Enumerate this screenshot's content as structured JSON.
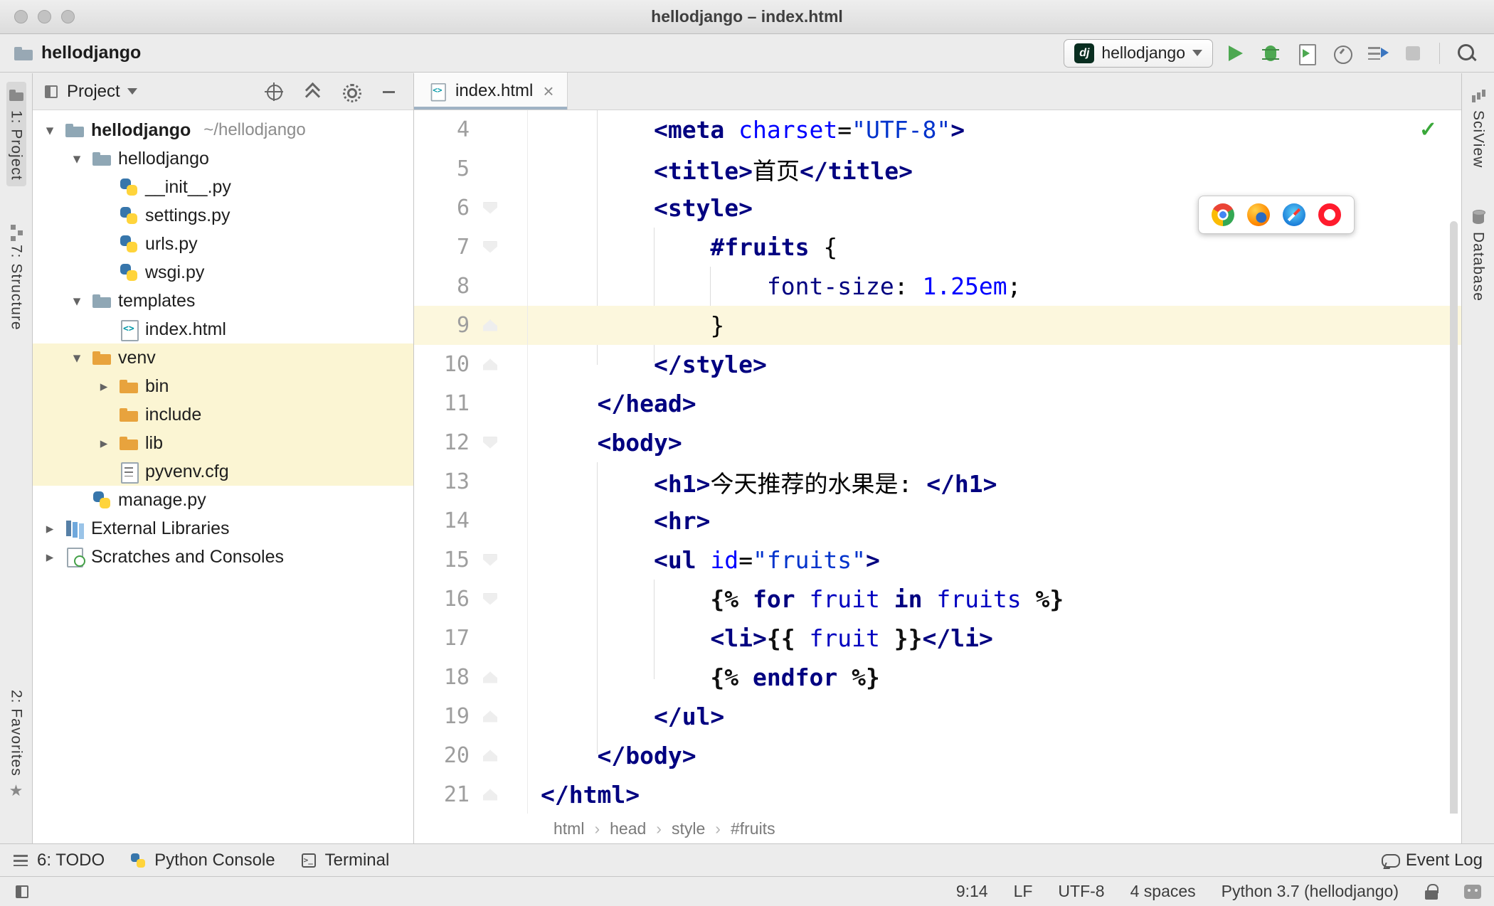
{
  "window": {
    "title": "hellodjango – index.html"
  },
  "toolbar": {
    "breadcrumb": "hellodjango",
    "run_config": "hellodjango",
    "run_config_icon_text": "dj",
    "actions": [
      "run",
      "debug",
      "run-with-coverage",
      "profiler",
      "concurrency-diagram",
      "stop"
    ],
    "search": "search-everywhere"
  },
  "colors": {
    "run_green": "#4DA851",
    "venv_highlight": "#fbf5d3",
    "current_line": "#fcf7dd",
    "tab_underline": "#9fb2c4"
  },
  "stripes": {
    "left_top": [
      {
        "label": "1: Project"
      },
      {
        "label": "7: Structure"
      }
    ],
    "left_bottom": [
      {
        "label": "2: Favorites"
      }
    ],
    "right_top": [
      {
        "label": "SciView"
      },
      {
        "label": "Database"
      }
    ]
  },
  "project": {
    "header": "Project",
    "header_actions": [
      "locate",
      "collapse-all",
      "settings",
      "hide"
    ],
    "tree": [
      {
        "label": "hellodjango",
        "hint": "~/hellodjango",
        "icon": "folder",
        "depth": 0,
        "chevron": "open",
        "bold": true
      },
      {
        "label": "hellodjango",
        "icon": "folder",
        "depth": 1,
        "chevron": "open"
      },
      {
        "label": "__init__.py",
        "icon": "python",
        "depth": 2
      },
      {
        "label": "settings.py",
        "icon": "python",
        "depth": 2
      },
      {
        "label": "urls.py",
        "icon": "python",
        "depth": 2
      },
      {
        "label": "wsgi.py",
        "icon": "python",
        "depth": 2
      },
      {
        "label": "templates",
        "icon": "folder",
        "depth": 1,
        "chevron": "open"
      },
      {
        "label": "index.html",
        "icon": "html",
        "depth": 2
      },
      {
        "label": "venv",
        "icon": "folder-orange",
        "depth": 1,
        "chevron": "open",
        "highlight": true
      },
      {
        "label": "bin",
        "icon": "folder-orange",
        "depth": 2,
        "chevron": "closed",
        "highlight": true
      },
      {
        "label": "include",
        "icon": "folder-orange",
        "depth": 2,
        "highlight": true
      },
      {
        "label": "lib",
        "icon": "folder-orange",
        "depth": 2,
        "chevron": "closed",
        "highlight": true
      },
      {
        "label": "pyvenv.cfg",
        "icon": "cfg",
        "depth": 2,
        "highlight": true
      },
      {
        "label": "manage.py",
        "icon": "python",
        "depth": 1
      },
      {
        "label": "External Libraries",
        "icon": "libraries",
        "depth": 0,
        "chevron": "closed"
      },
      {
        "label": "Scratches and Consoles",
        "icon": "scratches",
        "depth": 0,
        "chevron": "closed"
      }
    ]
  },
  "editor": {
    "tab": {
      "label": "index.html",
      "close": "×"
    },
    "inspection": "✓",
    "current_line": 9,
    "browser_popup": [
      "chrome",
      "firefox",
      "safari",
      "opera"
    ],
    "breadcrumbs": [
      "html",
      "head",
      "style",
      "#fruits"
    ],
    "lines": [
      {
        "n": 4,
        "indent": 8,
        "fold": null,
        "tokens": [
          [
            "tag",
            "<meta"
          ],
          [
            "pl",
            " "
          ],
          [
            "attr",
            "charset"
          ],
          [
            "pl",
            "="
          ],
          [
            "str",
            "\"UTF-8\""
          ],
          [
            "tag",
            ">"
          ]
        ]
      },
      {
        "n": 5,
        "indent": 8,
        "fold": null,
        "tokens": [
          [
            "tag",
            "<title>"
          ],
          [
            "pl",
            "首页"
          ],
          [
            "tag",
            "</title>"
          ]
        ]
      },
      {
        "n": 6,
        "indent": 8,
        "fold": "down",
        "tokens": [
          [
            "tag",
            "<style>"
          ]
        ]
      },
      {
        "n": 7,
        "indent": 12,
        "fold": "down",
        "tokens": [
          [
            "sel",
            "#fruits"
          ],
          [
            "pl",
            " {"
          ]
        ]
      },
      {
        "n": 8,
        "indent": 16,
        "fold": null,
        "tokens": [
          [
            "prop",
            "font-size"
          ],
          [
            "pl",
            ": "
          ],
          [
            "num",
            "1.25em"
          ],
          [
            "pl",
            ";"
          ]
        ]
      },
      {
        "n": 9,
        "indent": 12,
        "fold": "up",
        "tokens": [
          [
            "pl",
            "}"
          ]
        ]
      },
      {
        "n": 10,
        "indent": 8,
        "fold": "up",
        "tokens": [
          [
            "tag",
            "</style>"
          ]
        ]
      },
      {
        "n": 11,
        "indent": 4,
        "fold": null,
        "tokens": [
          [
            "tag",
            "</head>"
          ]
        ]
      },
      {
        "n": 12,
        "indent": 4,
        "fold": "down",
        "tokens": [
          [
            "tag",
            "<body>"
          ]
        ]
      },
      {
        "n": 13,
        "indent": 8,
        "fold": null,
        "tokens": [
          [
            "tag",
            "<h1>"
          ],
          [
            "pl",
            "今天推荐的水果是: "
          ],
          [
            "tag",
            "</h1>"
          ]
        ]
      },
      {
        "n": 14,
        "indent": 8,
        "fold": null,
        "tokens": [
          [
            "tag",
            "<hr>"
          ]
        ]
      },
      {
        "n": 15,
        "indent": 8,
        "fold": "down",
        "tokens": [
          [
            "tag",
            "<ul"
          ],
          [
            "pl",
            " "
          ],
          [
            "attr",
            "id"
          ],
          [
            "pl",
            "="
          ],
          [
            "str",
            "\"fruits\""
          ],
          [
            "tag",
            ">"
          ]
        ]
      },
      {
        "n": 16,
        "indent": 12,
        "fold": "down",
        "tokens": [
          [
            "br",
            "{%"
          ],
          [
            "pl",
            " "
          ],
          [
            "kw",
            "for"
          ],
          [
            "pl",
            " "
          ],
          [
            "var",
            "fruit"
          ],
          [
            "pl",
            " "
          ],
          [
            "kw",
            "in"
          ],
          [
            "pl",
            " "
          ],
          [
            "var",
            "fruits"
          ],
          [
            "pl",
            " "
          ],
          [
            "br",
            "%}"
          ]
        ]
      },
      {
        "n": 17,
        "indent": 12,
        "fold": null,
        "tokens": [
          [
            "tag",
            "<li>"
          ],
          [
            "br",
            "{{"
          ],
          [
            "pl",
            " "
          ],
          [
            "var",
            "fruit"
          ],
          [
            "pl",
            " "
          ],
          [
            "br",
            "}}"
          ],
          [
            "tag",
            "</li>"
          ]
        ]
      },
      {
        "n": 18,
        "indent": 12,
        "fold": "up",
        "tokens": [
          [
            "br",
            "{%"
          ],
          [
            "pl",
            " "
          ],
          [
            "kw",
            "endfor"
          ],
          [
            "pl",
            " "
          ],
          [
            "br",
            "%}"
          ]
        ]
      },
      {
        "n": 19,
        "indent": 8,
        "fold": "up",
        "tokens": [
          [
            "tag",
            "</ul>"
          ]
        ]
      },
      {
        "n": 20,
        "indent": 4,
        "fold": "up",
        "tokens": [
          [
            "tag",
            "</body>"
          ]
        ]
      },
      {
        "n": 21,
        "indent": 0,
        "fold": "up",
        "tokens": [
          [
            "tag",
            "</html>"
          ]
        ]
      }
    ]
  },
  "bottom_bar": {
    "items": [
      {
        "label": "6: TODO"
      },
      {
        "label": "Python Console"
      },
      {
        "label": "Terminal"
      }
    ],
    "event_log": "Event Log"
  },
  "status_bar": {
    "caret": "9:14",
    "line_sep": "LF",
    "encoding": "UTF-8",
    "indent": "4 spaces",
    "interpreter": "Python 3.7 (hellodjango)"
  }
}
